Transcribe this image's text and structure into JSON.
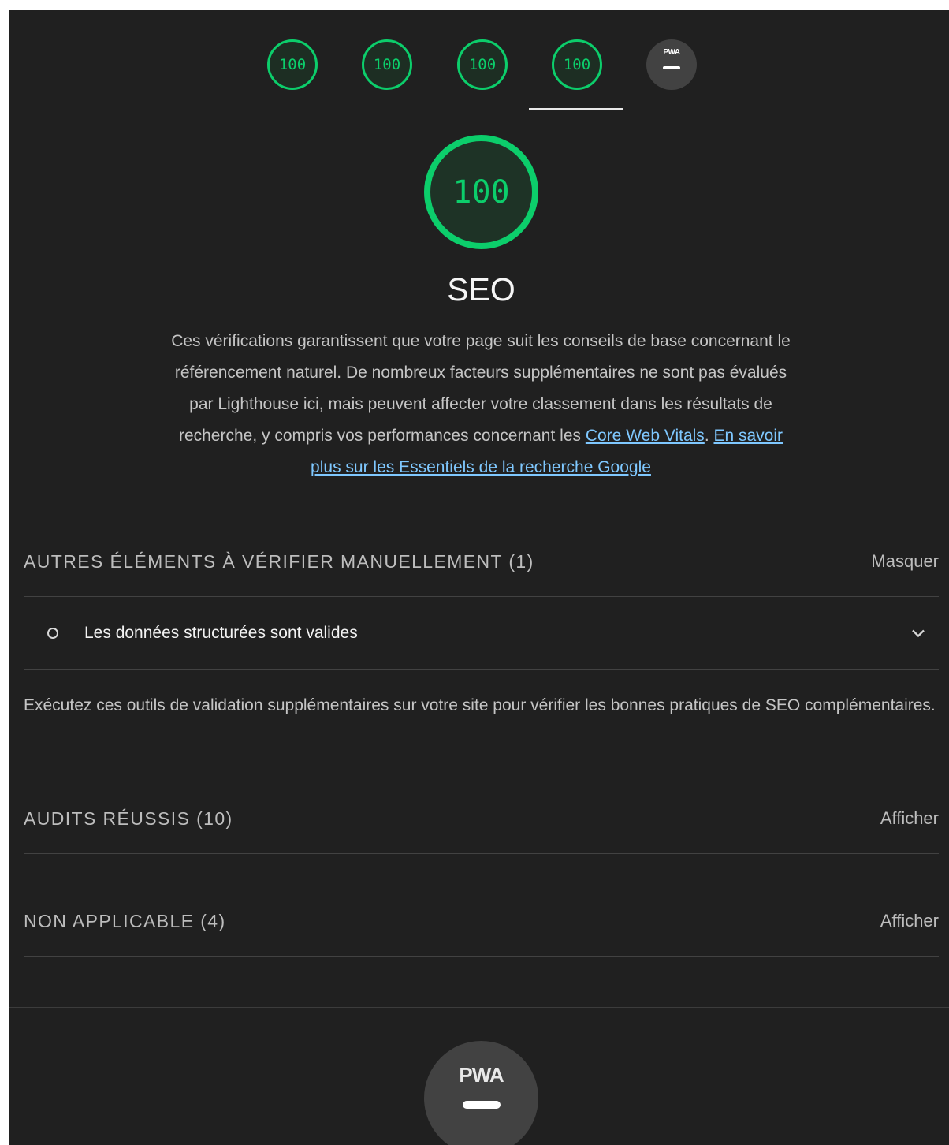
{
  "top_gauges": [
    {
      "score": "100",
      "name": "performance"
    },
    {
      "score": "100",
      "name": "accessibility"
    },
    {
      "score": "100",
      "name": "best-practices"
    },
    {
      "score": "100",
      "name": "seo"
    }
  ],
  "pwa_badge": {
    "label": "PWA"
  },
  "main": {
    "score": "100",
    "title": "SEO",
    "description_pre": "Ces vérifications garantissent que votre page suit les conseils de base concernant le référencement naturel. De nombreux facteurs supplémentaires ne sont pas évalués par Lighthouse ici, mais peuvent affecter votre classement dans les résultats de recherche, y compris vos performances concernant les ",
    "link1": "Core Web Vitals",
    "sep": ". ",
    "link2": "En savoir plus sur les Essentiels de la recherche Google"
  },
  "manual_section": {
    "title": "AUTRES ÉLÉMENTS À VÉRIFIER MANUELLEMENT (1)",
    "toggle": "Masquer",
    "audit": "Les données structurées sont valides",
    "help": "Exécutez ces outils de validation supplémentaires sur votre site pour vérifier les bonnes pratiques de SEO complémentaires."
  },
  "passed_section": {
    "title": "AUDITS RÉUSSIS (10)",
    "toggle": "Afficher"
  },
  "na_section": {
    "title": "NON APPLICABLE (4)",
    "toggle": "Afficher"
  },
  "colors": {
    "pass": "#0cce6b",
    "background": "#202020",
    "link": "#7fc8ff"
  }
}
